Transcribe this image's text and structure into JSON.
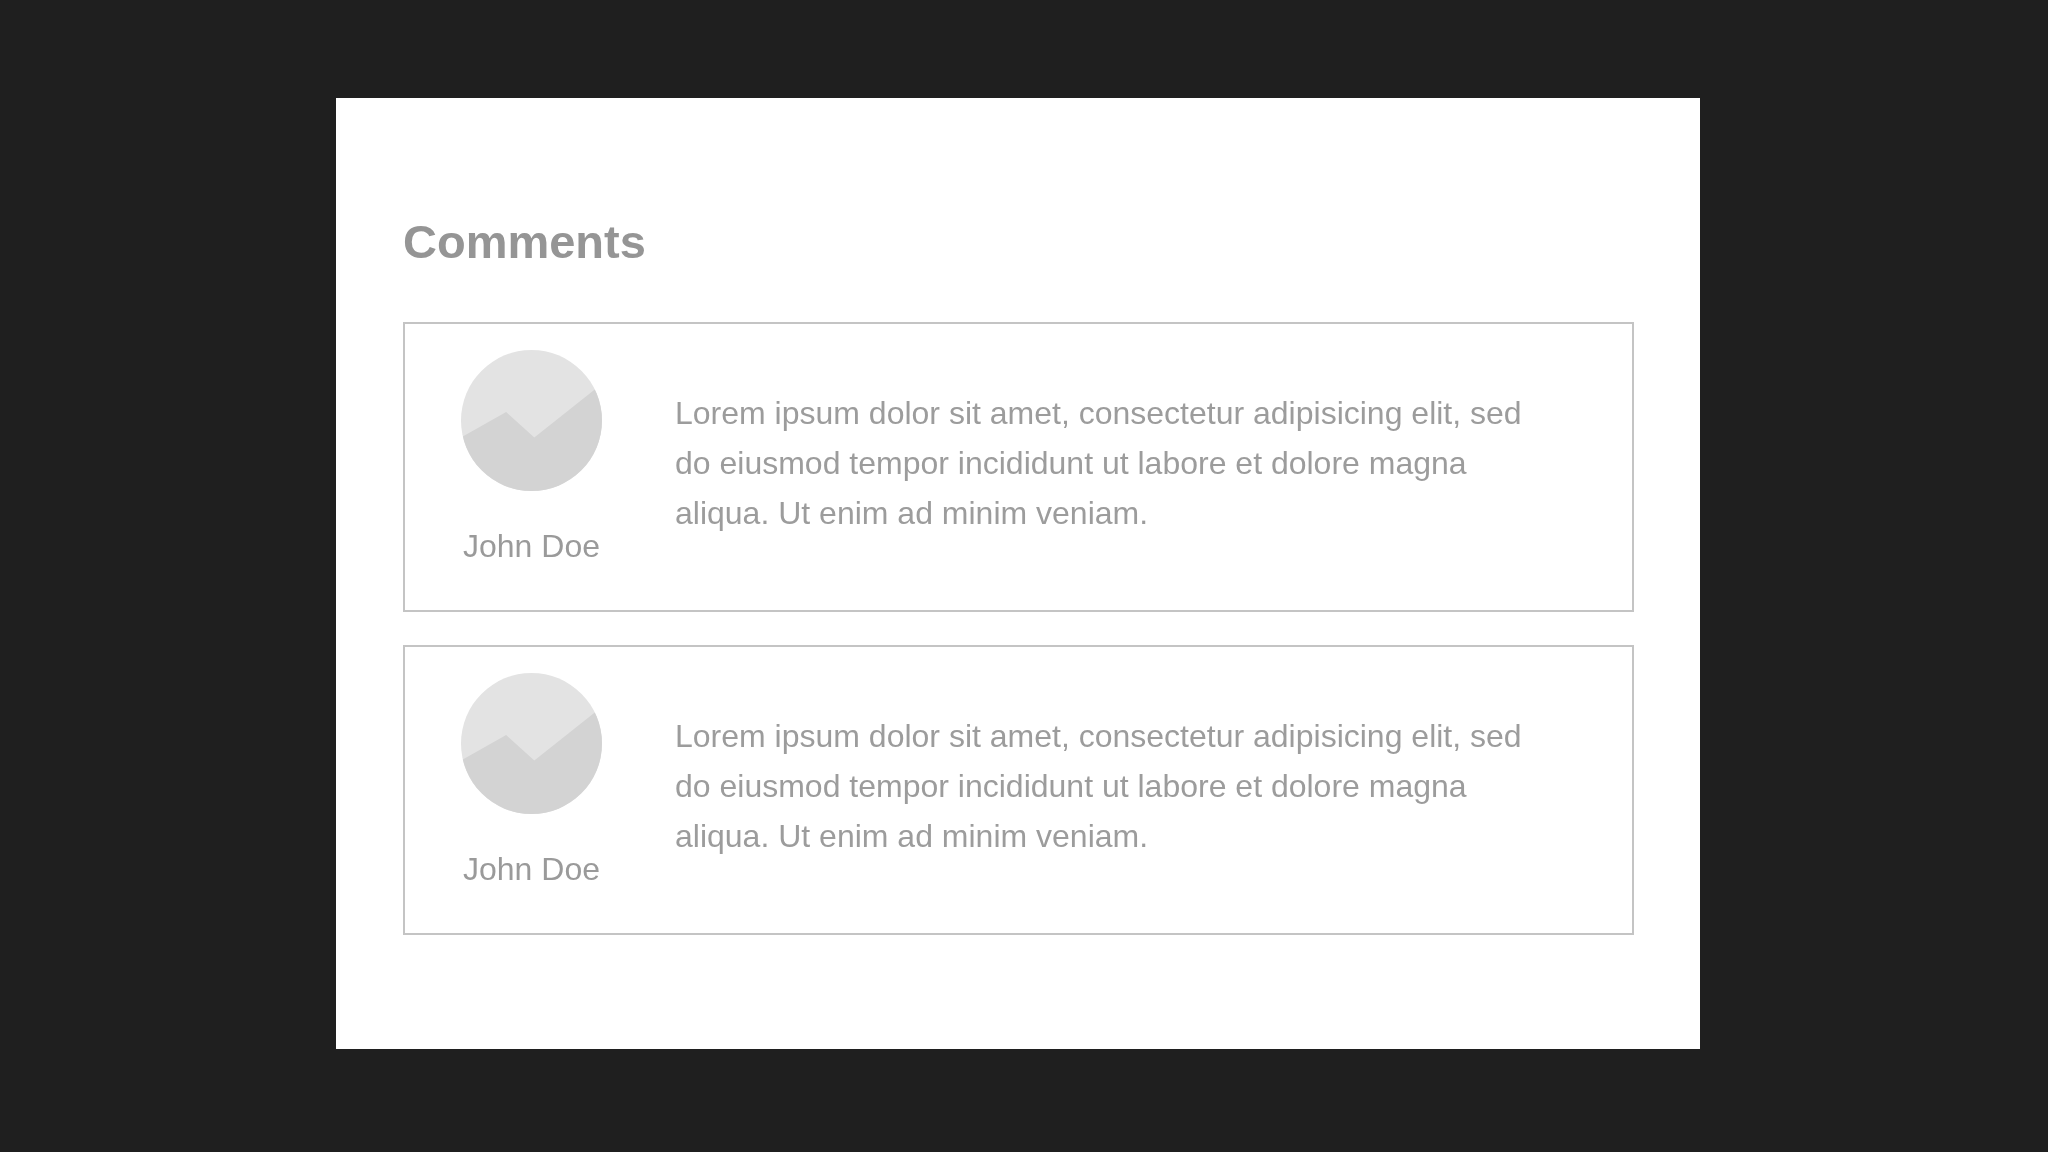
{
  "title": "Comments",
  "comments": [
    {
      "author": "John Doe",
      "text": "Lorem ipsum dolor sit amet, consectetur adipisicing elit, sed do eiusmod tempor incididunt ut labore et dolore magna aliqua. Ut enim ad minim veniam."
    },
    {
      "author": "John Doe",
      "text": "Lorem ipsum dolor sit amet, consectetur adipisicing elit, sed do eiusmod tempor incididunt ut labore et dolore magna aliqua. Ut enim ad minim veniam."
    }
  ]
}
